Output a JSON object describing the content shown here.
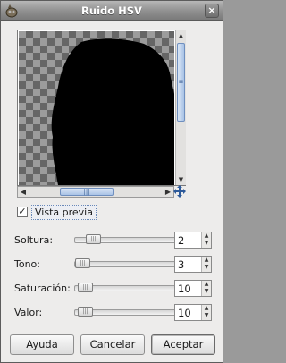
{
  "window": {
    "title": "Ruido HSV"
  },
  "preview": {
    "toggle_label": "Vista previa",
    "toggle_checked": true
  },
  "params": [
    {
      "label": "Soltura:",
      "mnemonic_index": 0,
      "value": "2"
    },
    {
      "label": "Tono:",
      "mnemonic_index": 0,
      "value": "3"
    },
    {
      "label": "Saturación:",
      "mnemonic_index": 0,
      "value": "10"
    },
    {
      "label": "Valor:",
      "mnemonic_index": 0,
      "value": "10"
    }
  ],
  "buttons": {
    "help": "Ayuda",
    "cancel": "Cancelar",
    "ok": "Aceptar"
  }
}
